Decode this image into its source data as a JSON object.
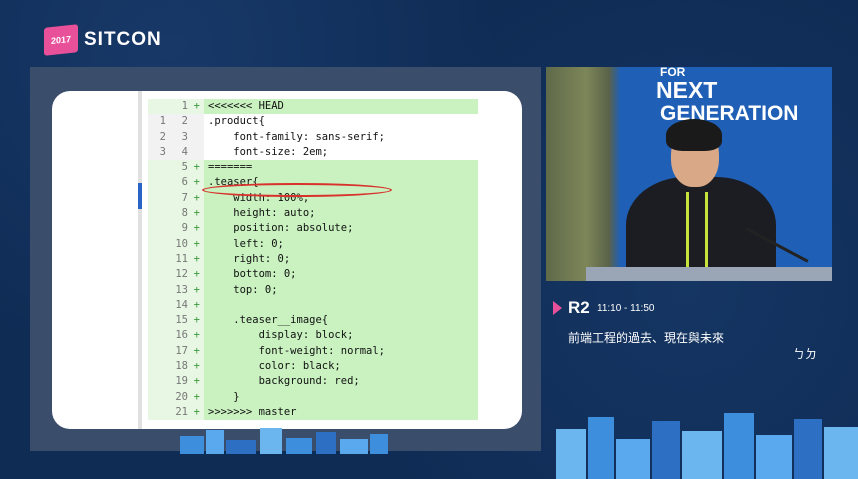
{
  "logo": {
    "year": "2017",
    "name": "SITCON"
  },
  "slide": {
    "code_lines": [
      {
        "old": "",
        "new": "1",
        "sign": "+",
        "text": "<<<<<<< HEAD",
        "add": true
      },
      {
        "old": "1",
        "new": "2",
        "sign": "",
        "text": ".product{",
        "add": false
      },
      {
        "old": "2",
        "new": "3",
        "sign": "",
        "text": "    font-family: sans-serif;",
        "add": false
      },
      {
        "old": "3",
        "new": "4",
        "sign": "",
        "text": "    font-size: 2em;",
        "add": false
      },
      {
        "old": "",
        "new": "5",
        "sign": "+",
        "text": "=======",
        "add": true
      },
      {
        "old": "",
        "new": "6",
        "sign": "+",
        "text": ".teaser{",
        "add": true
      },
      {
        "old": "",
        "new": "7",
        "sign": "+",
        "text": "    width: 100%;",
        "add": true
      },
      {
        "old": "",
        "new": "8",
        "sign": "+",
        "text": "    height: auto;",
        "add": true
      },
      {
        "old": "",
        "new": "9",
        "sign": "+",
        "text": "    position: absolute;",
        "add": true
      },
      {
        "old": "",
        "new": "10",
        "sign": "+",
        "text": "    left: 0;",
        "add": true
      },
      {
        "old": "",
        "new": "11",
        "sign": "+",
        "text": "    right: 0;",
        "add": true
      },
      {
        "old": "",
        "new": "12",
        "sign": "+",
        "text": "    bottom: 0;",
        "add": true
      },
      {
        "old": "",
        "new": "13",
        "sign": "+",
        "text": "    top: 0;",
        "add": true
      },
      {
        "old": "",
        "new": "14",
        "sign": "+",
        "text": "",
        "add": true
      },
      {
        "old": "",
        "new": "15",
        "sign": "+",
        "text": "    .teaser__image{",
        "add": true
      },
      {
        "old": "",
        "new": "16",
        "sign": "+",
        "text": "        display: block;",
        "add": true
      },
      {
        "old": "",
        "new": "17",
        "sign": "+",
        "text": "        font-weight: normal;",
        "add": true
      },
      {
        "old": "",
        "new": "18",
        "sign": "+",
        "text": "        color: black;",
        "add": true
      },
      {
        "old": "",
        "new": "19",
        "sign": "+",
        "text": "        background: red;",
        "add": true
      },
      {
        "old": "",
        "new": "20",
        "sign": "+",
        "text": "    }",
        "add": true
      },
      {
        "old": "",
        "new": "21",
        "sign": "+",
        "text": ">>>>>>> master",
        "add": true
      }
    ]
  },
  "camera": {
    "line1": "FOR",
    "line2": "NEXT",
    "line3": "GENERATION"
  },
  "session": {
    "room": "R2",
    "time": "11:10 - 11:50",
    "title": "前端工程的過去、現在與未來",
    "speaker": "ㄅㄉ"
  },
  "colors": {
    "background": "#0f2c55",
    "accent": "#e8509a",
    "diff_add": "#c9f2c0"
  }
}
